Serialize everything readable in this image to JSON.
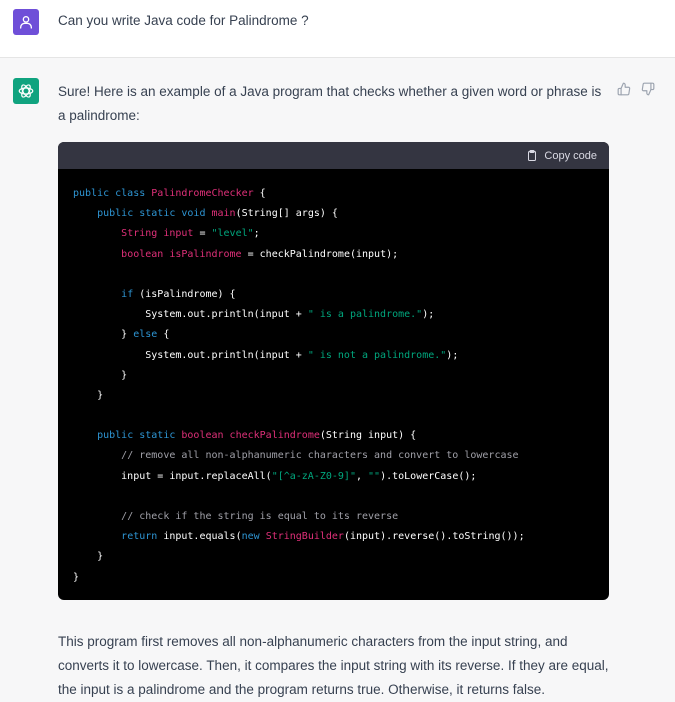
{
  "user_message": "Can you write Java code for Palindrome ?",
  "assistant": {
    "intro": "Sure! Here is an example of a Java program that checks whether a given word or phrase is a palindrome:",
    "copy_code_label": "Copy code",
    "outro": "This program first removes all non-alphanumeric characters from the input string, and converts it to lowercase. Then, it compares the input string with its reverse. If they are equal, the input is a palindrome and the program returns true. Otherwise, it returns false."
  },
  "icons": {
    "user_avatar": "person-icon",
    "assistant_avatar": "openai-logo-icon",
    "thumbs_up": "thumbs-up-icon",
    "thumbs_down": "thumbs-down-icon",
    "copy": "clipboard-icon"
  },
  "colors": {
    "user_avatar_bg": "#6f4fd8",
    "assistant_avatar_bg": "#10a37f",
    "keyword": "#2e95d3",
    "class_name": "#df3079",
    "string": "#00a67d",
    "comment": "#a0a0a8"
  },
  "code_lines": [
    [
      [
        "kw",
        "public class "
      ],
      [
        "cls",
        "PalindromeChecker"
      ],
      [
        "plain",
        " {"
      ]
    ],
    [
      [
        "plain",
        "    "
      ],
      [
        "kw",
        "public static void "
      ],
      [
        "cls",
        "main"
      ],
      [
        "plain",
        "(String[] args) {"
      ]
    ],
    [
      [
        "plain",
        "        "
      ],
      [
        "cls",
        "String input"
      ],
      [
        "plain",
        " = "
      ],
      [
        "str",
        "\"level\""
      ],
      [
        "plain",
        ";"
      ]
    ],
    [
      [
        "plain",
        "        "
      ],
      [
        "cls",
        "boolean isPalindrome"
      ],
      [
        "plain",
        " = checkPalindrome(input);"
      ]
    ],
    [],
    [
      [
        "plain",
        "        "
      ],
      [
        "kw",
        "if"
      ],
      [
        "plain",
        " (isPalindrome) {"
      ]
    ],
    [
      [
        "plain",
        "            System.out.println(input + "
      ],
      [
        "str",
        "\" is a palindrome.\""
      ],
      [
        "plain",
        ");"
      ]
    ],
    [
      [
        "plain",
        "        } "
      ],
      [
        "kw",
        "else"
      ],
      [
        "plain",
        " {"
      ]
    ],
    [
      [
        "plain",
        "            System.out.println(input + "
      ],
      [
        "str",
        "\" is not a palindrome.\""
      ],
      [
        "plain",
        ");"
      ]
    ],
    [
      [
        "plain",
        "        }"
      ]
    ],
    [
      [
        "plain",
        "    }"
      ]
    ],
    [],
    [
      [
        "plain",
        "    "
      ],
      [
        "kw",
        "public static "
      ],
      [
        "cls",
        "boolean checkPalindrome"
      ],
      [
        "plain",
        "(String input) {"
      ]
    ],
    [
      [
        "plain",
        "        "
      ],
      [
        "com",
        "// remove all non-alphanumeric characters and convert to lowercase"
      ]
    ],
    [
      [
        "plain",
        "        input = input.replaceAll("
      ],
      [
        "str",
        "\"[^a-zA-Z0-9]\""
      ],
      [
        "plain",
        ", "
      ],
      [
        "str",
        "\"\""
      ],
      [
        "plain",
        ").toLowerCase();"
      ]
    ],
    [],
    [
      [
        "plain",
        "        "
      ],
      [
        "com",
        "// check if the string is equal to its reverse"
      ]
    ],
    [
      [
        "plain",
        "        "
      ],
      [
        "kw",
        "return"
      ],
      [
        "plain",
        " input.equals("
      ],
      [
        "kw",
        "new "
      ],
      [
        "cls",
        "StringBuilder"
      ],
      [
        "plain",
        "(input).reverse().toString());"
      ]
    ],
    [
      [
        "plain",
        "    }"
      ]
    ],
    [
      [
        "plain",
        "}"
      ]
    ]
  ]
}
